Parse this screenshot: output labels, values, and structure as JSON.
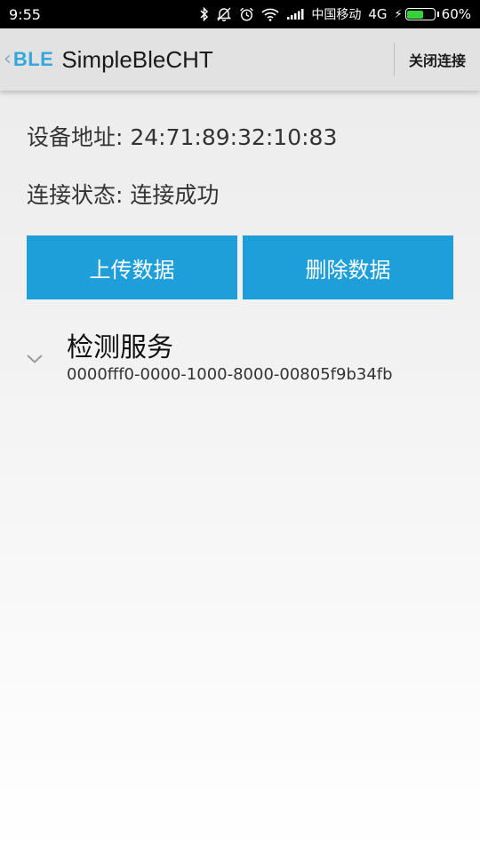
{
  "status_bar": {
    "time": "9:55",
    "carrier": "中国移动",
    "network": "4G",
    "battery_percent": "60%",
    "battery_level": 0.6,
    "icons": [
      "bluetooth-icon",
      "mute-icon",
      "alarm-icon",
      "wifi-icon",
      "signal-icon",
      "charging-icon",
      "battery-icon"
    ]
  },
  "action_bar": {
    "app_icon_text": "BLE",
    "title": "SimpleBleCHT",
    "disconnect_label": "关闭连接"
  },
  "device": {
    "address_line": "设备地址: 24:71:89:32:10:83",
    "state_line": "连接状态: 连接成功"
  },
  "buttons": {
    "upload_label": "上传数据",
    "delete_label": "删除数据"
  },
  "services": [
    {
      "title": "检测服务",
      "uuid": "0000fff0-0000-1000-8000-00805f9b34fb"
    }
  ],
  "colors": {
    "accent": "#1e9fd9",
    "battery_green": "#35d338",
    "app_icon": "#35a7dd"
  }
}
